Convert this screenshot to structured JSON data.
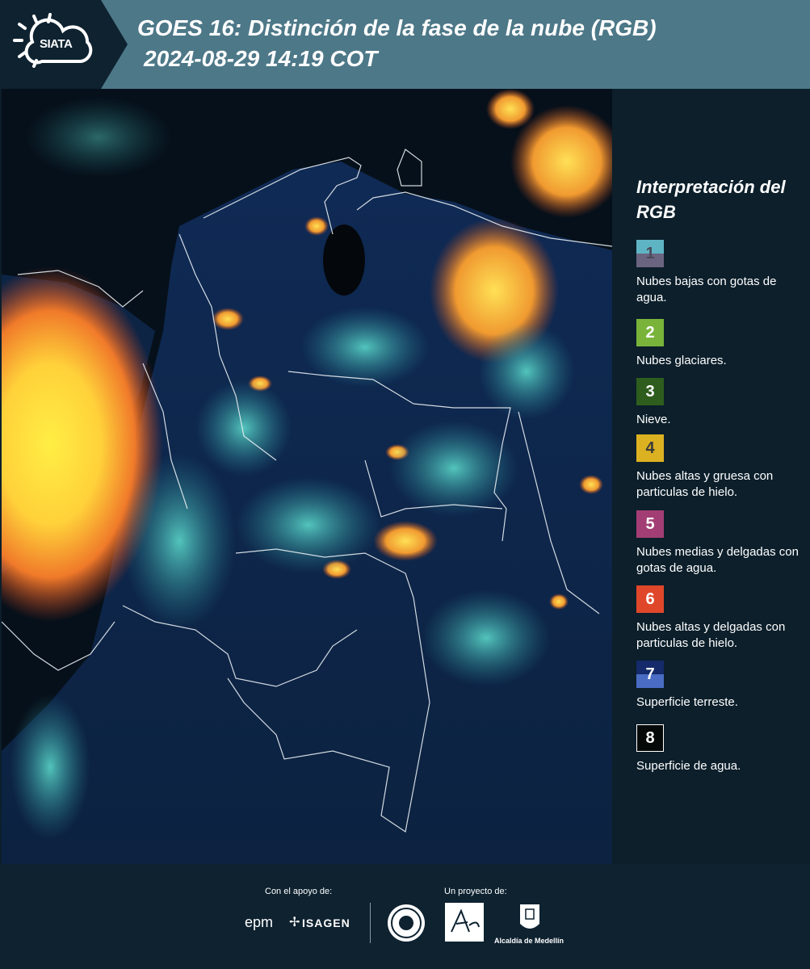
{
  "header": {
    "logo_text": "SIATA",
    "title_line1": "GOES 16: Distinción de la fase de la nube (RGB)",
    "title_line2": "2024-08-29 14:19 COT"
  },
  "legend": {
    "title": "Interpretación del RGB",
    "items": [
      {
        "number": "1",
        "label": "Nubes bajas con gotas de agua.",
        "color_top": "#5fb4c4",
        "color_bottom": "#6b6480"
      },
      {
        "number": "2",
        "label": "Nubes glaciares.",
        "color": "#79b33a"
      },
      {
        "number": "3",
        "label": "Nieve.",
        "color": "#2e5d1e"
      },
      {
        "number": "4",
        "label": "Nubes altas y gruesa con particulas de hielo.",
        "color": "#dcb121"
      },
      {
        "number": "5",
        "label": "Nubes medias y delgadas con gotas de agua.",
        "color": "#a33e75"
      },
      {
        "number": "6",
        "label": "Nubes altas y delgadas con particulas de hielo.",
        "color": "#e0472a"
      },
      {
        "number": "7",
        "label": "Superficie terreste.",
        "color_top": "#152a6a",
        "color_bottom": "#4a6cc4"
      },
      {
        "number": "8",
        "label": "Superficie de agua.",
        "color": "#050a08"
      }
    ]
  },
  "footer": {
    "support_label": "Con el apoyo de:",
    "project_label": "Un proyecto de:",
    "sponsors": [
      "epm",
      "ISAGEN"
    ],
    "partners": [
      "Área Metropolitana",
      "Alcaldía de Medellín"
    ]
  }
}
